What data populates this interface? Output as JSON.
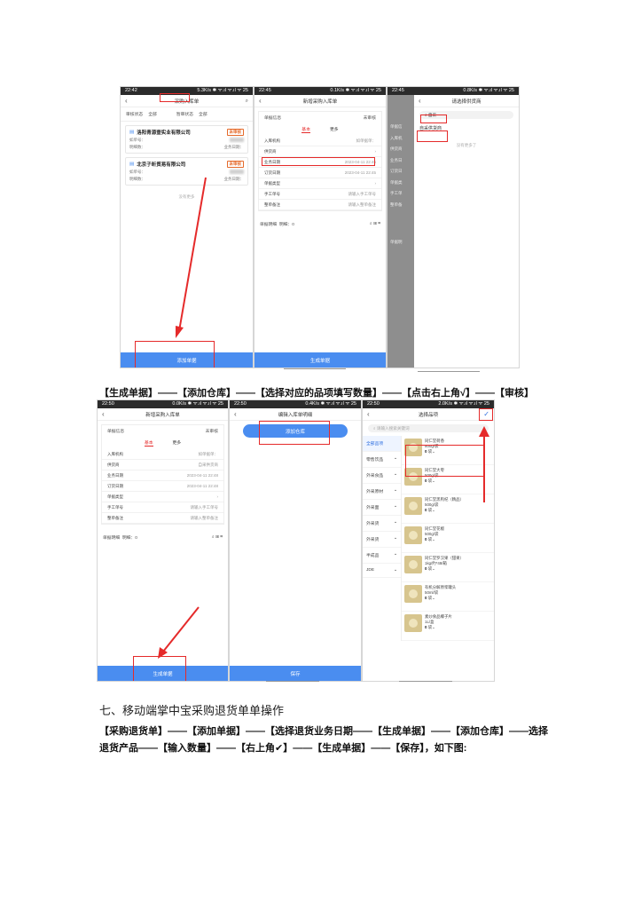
{
  "screens_row1": {
    "s1": {
      "status_time": "22:42",
      "status_right": "5.3K/s ✱ ᯤ.ıl ᯤ.ıl ᯤ 25",
      "title": "采购入库单",
      "filters": [
        "审核状态",
        "全部",
        "暂审状态",
        "全部"
      ],
      "cards": [
        {
          "name": "洛阳青源壹实业有限公司",
          "badge": "未审核",
          "k1": "如单号：",
          "k2": "明细数：",
          "k3": "业务日期："
        },
        {
          "name": "北京子昕贸易有限公司",
          "badge": "未审核",
          "k1": "如单号：",
          "k2": "明细数：",
          "k3": "业务日期："
        }
      ],
      "empty": "没有更多",
      "button": "添加单据"
    },
    "s2": {
      "status_time": "22:45",
      "status_right": "0.1K/s ✱ ᯤ.ıl ᯤ.ıl ᯤ 25",
      "title": "新增采购入库单",
      "section": "单据信息",
      "section_status": "未审核",
      "tabs": [
        "基本",
        "更多"
      ],
      "rows": [
        {
          "k": "入库机构",
          "v": "如单据单："
        },
        {
          "k": "供货商",
          "v": ""
        },
        {
          "k": "业务日期",
          "v": "2023-04-11 22:45"
        },
        {
          "k": "订货日期",
          "v": "2023-04-11 22:45"
        },
        {
          "k": "单据类型",
          "v": ""
        },
        {
          "k": "手工单号",
          "v": "请输入手工单号"
        },
        {
          "k": "整单备注",
          "v": "请输入整单备注"
        }
      ],
      "detail_head": "单据明细",
      "detail_count": "明细：0",
      "button": "生成单据"
    },
    "s3": {
      "status_time": "22:45",
      "status_right": "0.8K/s ✱ ᯤ.ıl ᯤ.ıl ᯤ 25",
      "title": "请选择供货商",
      "search_value": "自采",
      "result": "自采供货商",
      "empty": "没有更多了",
      "side_items": [
        "单据信",
        "入库机",
        "供货商",
        "业务日",
        "订货日",
        "单据类",
        "手工单",
        "整单备",
        "单据明"
      ]
    }
  },
  "caption1": "【生成单据】——【添加仓库】——【选择对应的品项填写数量】——【点击右上角√】——【审核】",
  "screens_row2": {
    "s4": {
      "status_time": "22:50",
      "status_right": "0.0K/s ✱ ᯤ.ıl ᯤ.ıl ᯤ 25",
      "title": "新增采购入库单",
      "section": "单据信息",
      "section_status": "未审核",
      "tabs": [
        "基本",
        "更多"
      ],
      "rows": [
        {
          "k": "入库机构",
          "v": "如单据单："
        },
        {
          "k": "供货商",
          "v": "自采供货商"
        },
        {
          "k": "业务日期",
          "v": "2023-04-11 22:48"
        },
        {
          "k": "订货日期",
          "v": "2023-04-11 22:48"
        },
        {
          "k": "单据类型",
          "v": ""
        },
        {
          "k": "手工单号",
          "v": "请输入手工单号"
        },
        {
          "k": "整单备注",
          "v": "请输入整单备注"
        }
      ],
      "detail_head": "单据明细",
      "detail_count": "明细：0",
      "button": "生成单据"
    },
    "s5": {
      "status_time": "22:50",
      "status_right": "0.4K/s ✱ ᯤ.ıl ᯤ.ıl ᯤ 25",
      "title": "编辑入库单明细",
      "add_button": "添加仓库",
      "button": "保存"
    },
    "s6": {
      "status_time": "22:50",
      "status_right": "2.0K/s ✱ ᯤ.ıl ᯤ.ıl ᯤ 25",
      "title": "选择品项",
      "search_placeholder": "请输入搜索关键词",
      "categories": [
        "全部品项",
        "零售饮品",
        "外采食品",
        "外采原材",
        "外采面",
        "外采货",
        "外采货",
        "半成品",
        "JDE"
      ],
      "products": [
        {
          "name": "同仁堂荷香",
          "spec": "500g/袋",
          "qty": "0",
          "unit": "袋"
        },
        {
          "name": "同仁堂大枣",
          "spec": "500g/袋",
          "qty": "0",
          "unit": "袋"
        },
        {
          "name": "同仁堂黑枸杞（精品）",
          "spec": "500g/袋",
          "qty": "0",
          "unit": "袋"
        },
        {
          "name": "同仁堂花椒",
          "spec": "500g/袋",
          "qty": "0",
          "unit": "袋"
        },
        {
          "name": "同仁堂罗汉果（甜果）",
          "spec": "1kg/约*48/箱",
          "qty": "0",
          "unit": "袋"
        },
        {
          "name": "有机分解原浆罐头",
          "spec": "50ml/袋",
          "qty": "0",
          "unit": "袋"
        },
        {
          "name": "素炒食品椰子片",
          "spec": "1L/盒",
          "qty": "0",
          "unit": "袋"
        }
      ]
    }
  },
  "heading": "七、移动端掌中宝采购退货单单操作",
  "paragraph": "【采购退货单】——【添加单据】——【选择退货业务日期——【生成单据】——【添加仓库】——选择退货产品——【输入数量】——【右上角✔】——【生成单据】——【保存】，如下图:",
  "colors": {
    "accent": "#4a8df0",
    "highlight": "#e52a2a"
  }
}
